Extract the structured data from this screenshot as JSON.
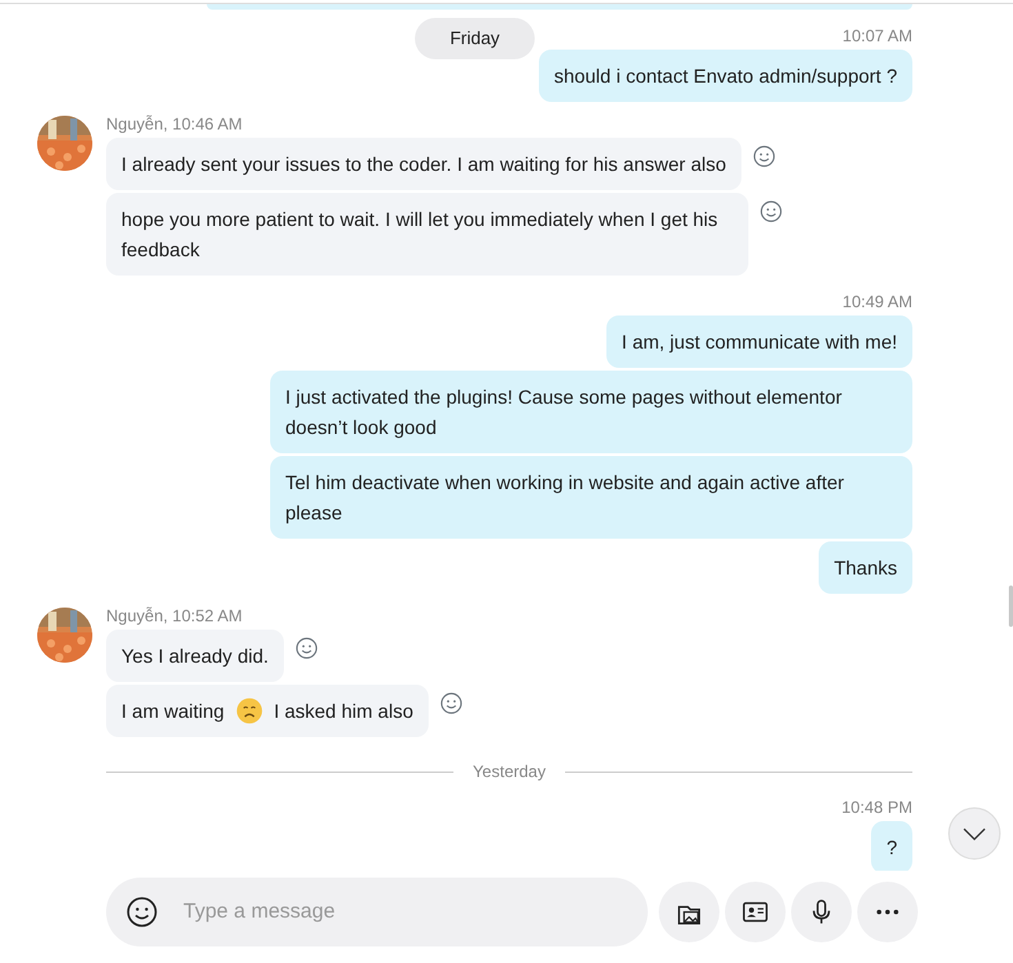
{
  "items": [
    {
      "kind": "cut"
    },
    {
      "kind": "day",
      "label": "Friday"
    },
    {
      "kind": "outgoing",
      "time": "10:07 AM",
      "messages": [
        {
          "segments": [
            {
              "kind": "text",
              "text": "should i contact Envato admin/support ?"
            }
          ]
        }
      ]
    },
    {
      "kind": "incoming",
      "header": "Nguyễn, 10:46 AM",
      "messages": [
        {
          "segments": [
            {
              "kind": "text",
              "text": "I already sent your issues to the coder. I am waiting for his answer also"
            }
          ]
        },
        {
          "segments": [
            {
              "kind": "text",
              "text": "hope you more patient to wait. I will let you immediately when I get his feedback"
            }
          ]
        }
      ]
    },
    {
      "kind": "outgoing",
      "time": "10:49 AM",
      "messages": [
        {
          "segments": [
            {
              "kind": "text",
              "text": "I am, just communicate with me!"
            }
          ]
        },
        {
          "segments": [
            {
              "kind": "text",
              "text": "I just activated the plugins! Cause some pages without elementor doesn’t look good"
            }
          ]
        },
        {
          "segments": [
            {
              "kind": "text",
              "text": "Tel him deactivate when working in website and again active after please"
            }
          ]
        },
        {
          "segments": [
            {
              "kind": "text",
              "text": "Thanks"
            }
          ]
        }
      ]
    },
    {
      "kind": "incoming",
      "header": "Nguyễn, 10:52 AM",
      "messages": [
        {
          "segments": [
            {
              "kind": "text",
              "text": "Yes I already did."
            }
          ]
        },
        {
          "segments": [
            {
              "kind": "text",
              "text": "I am waiting"
            },
            {
              "kind": "emoji"
            },
            {
              "kind": "text",
              "text": "I asked him also"
            }
          ]
        }
      ]
    },
    {
      "kind": "divider",
      "label": "Yesterday"
    },
    {
      "kind": "outgoing",
      "time": "10:48 PM",
      "messages": [
        {
          "segments": [
            {
              "kind": "text",
              "text": "?"
            }
          ]
        }
      ]
    }
  ],
  "composer": {
    "placeholder": "Type a message"
  }
}
